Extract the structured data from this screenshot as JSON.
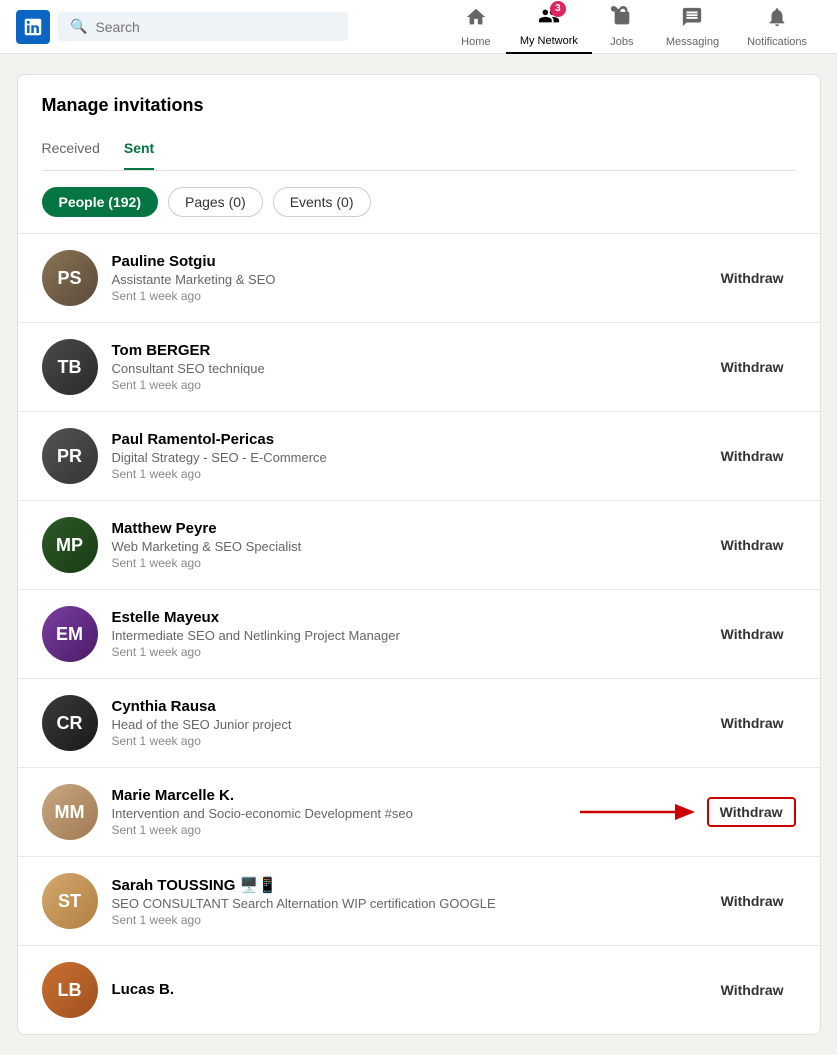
{
  "nav": {
    "logo_alt": "LinkedIn",
    "search_placeholder": "Search",
    "items": [
      {
        "id": "home",
        "label": "Home",
        "icon": "🏠",
        "badge": null,
        "active": false
      },
      {
        "id": "my-network",
        "label": "My Network",
        "icon": "👥",
        "badge": "3",
        "active": true
      },
      {
        "id": "jobs",
        "label": "Jobs",
        "icon": "💼",
        "badge": null,
        "active": false
      },
      {
        "id": "messaging",
        "label": "Messaging",
        "icon": "💬",
        "badge": null,
        "active": false
      },
      {
        "id": "notifications",
        "label": "Notifications",
        "icon": "🔔",
        "badge": null,
        "active": false
      }
    ]
  },
  "page": {
    "title": "Manage invitations",
    "tabs": [
      {
        "id": "received",
        "label": "Received",
        "active": false
      },
      {
        "id": "sent",
        "label": "Sent",
        "active": true
      }
    ],
    "filters": [
      {
        "id": "people",
        "label": "People (192)",
        "active": true
      },
      {
        "id": "pages",
        "label": "Pages (0)",
        "active": false
      },
      {
        "id": "events",
        "label": "Events (0)",
        "active": false
      }
    ],
    "invitations": [
      {
        "id": 1,
        "name": "Pauline Sotgiu",
        "title": "Assistante Marketing & SEO",
        "sent": "Sent 1 week ago",
        "withdraw_label": "Withdraw",
        "highlighted": false,
        "avatar_color1": "#8B7355",
        "avatar_color2": "#5a4a3a",
        "initials": "PS"
      },
      {
        "id": 2,
        "name": "Tom BERGER",
        "title": "Consultant SEO technique",
        "sent": "Sent 1 week ago",
        "withdraw_label": "Withdraw",
        "highlighted": false,
        "avatar_color1": "#4a4a4a",
        "avatar_color2": "#2a2a2a",
        "initials": "TB"
      },
      {
        "id": 3,
        "name": "Paul Ramentol-Pericas",
        "title": "Digital Strategy - SEO - E-Commerce",
        "sent": "Sent 1 week ago",
        "withdraw_label": "Withdraw",
        "highlighted": false,
        "avatar_color1": "#555555",
        "avatar_color2": "#333333",
        "initials": "PR"
      },
      {
        "id": 4,
        "name": "Matthew Peyre",
        "title": "Web Marketing & SEO Specialist",
        "sent": "Sent 1 week ago",
        "withdraw_label": "Withdraw",
        "highlighted": false,
        "avatar_color1": "#2d5a27",
        "avatar_color2": "#1a3a15",
        "initials": "MP"
      },
      {
        "id": 5,
        "name": "Estelle Mayeux",
        "title": "Intermediate SEO and Netlinking Project Manager",
        "sent": "Sent 1 week ago",
        "withdraw_label": "Withdraw",
        "highlighted": false,
        "avatar_color1": "#7b3fa0",
        "avatar_color2": "#4a1a6a",
        "initials": "EM"
      },
      {
        "id": 6,
        "name": "Cynthia Rausa",
        "title": "Head of the SEO Junior project",
        "sent": "Sent 1 week ago",
        "withdraw_label": "Withdraw",
        "highlighted": false,
        "avatar_color1": "#3a3a3a",
        "avatar_color2": "#1a1a1a",
        "initials": "CR"
      },
      {
        "id": 7,
        "name": "Marie Marcelle K.",
        "title": "Intervention and Socio-economic Development #seo",
        "sent": "Sent 1 week ago",
        "withdraw_label": "Withdraw",
        "highlighted": true,
        "avatar_color1": "#c8a882",
        "avatar_color2": "#a07850",
        "initials": "MM"
      },
      {
        "id": 8,
        "name": "Sarah TOUSSING 🖥️📱",
        "title": "SEO CONSULTANT Search Alternation WIP certification GOOGLE",
        "sent": "Sent 1 week ago",
        "withdraw_label": "Withdraw",
        "highlighted": false,
        "avatar_color1": "#d4a870",
        "avatar_color2": "#b08040",
        "initials": "ST"
      },
      {
        "id": 9,
        "name": "Lucas B.",
        "title": "",
        "sent": "",
        "withdraw_label": "Withdraw",
        "highlighted": false,
        "avatar_color1": "#c87030",
        "avatar_color2": "#a05020",
        "initials": "LB"
      }
    ]
  }
}
